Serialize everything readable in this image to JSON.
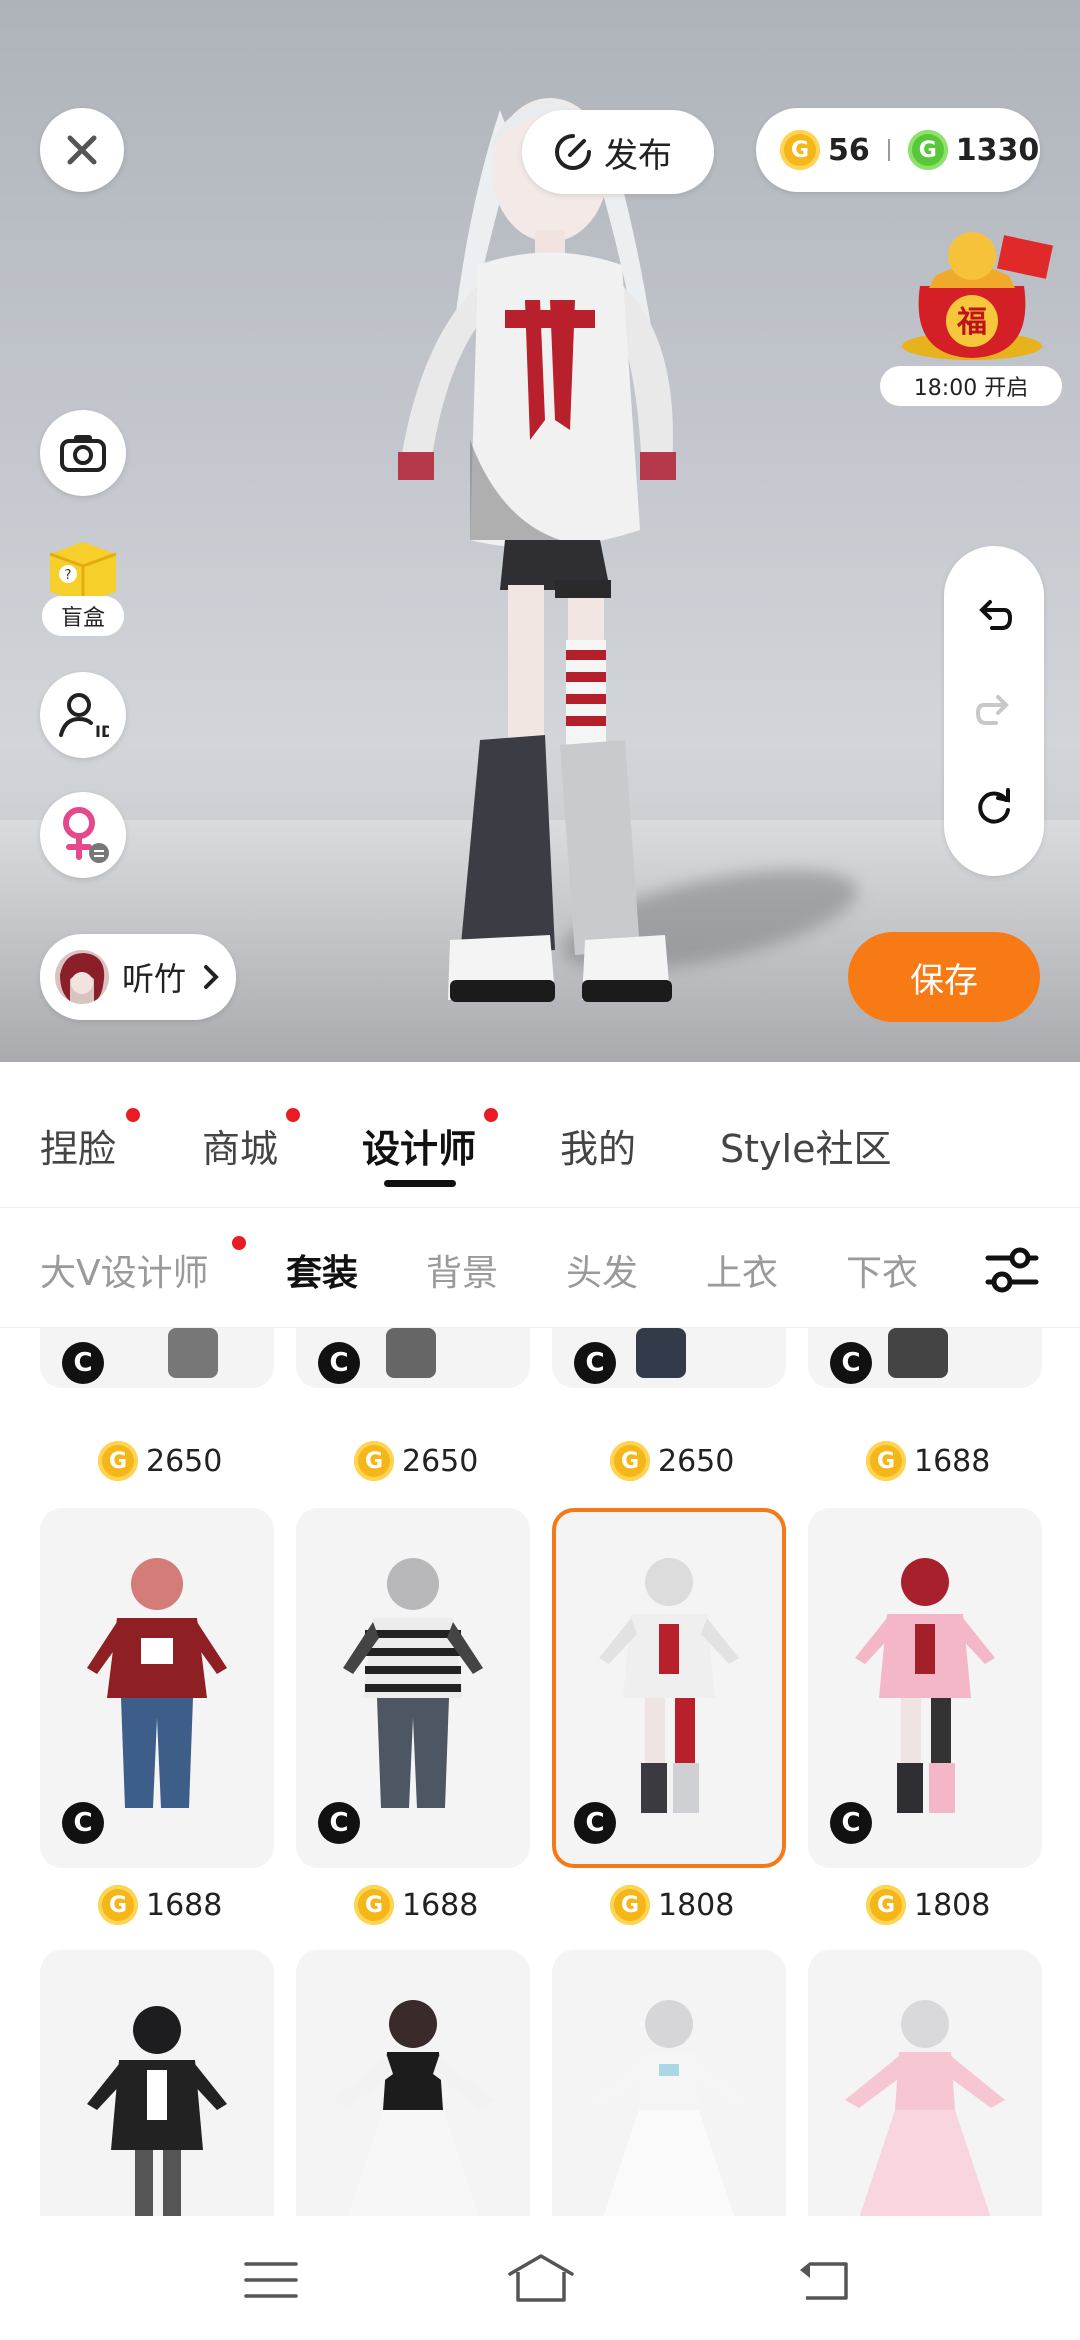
{
  "header": {
    "publish_label": "发布",
    "gold_coins": "56",
    "green_coins": "1330",
    "event_time": "18:00 开启",
    "event_icon_text": "福"
  },
  "left_tools": {
    "blindbox_label": "盲盒"
  },
  "user": {
    "name": "听竹"
  },
  "save_label": "保存",
  "main_tabs": [
    {
      "label": "捏脸",
      "dot": true
    },
    {
      "label": "商城",
      "dot": true
    },
    {
      "label": "设计师",
      "dot": true,
      "active": true
    },
    {
      "label": "我的",
      "dot": false
    },
    {
      "label": "Style社区",
      "dot": false
    }
  ],
  "sub_tabs": [
    {
      "label": "大V设计师",
      "dot": true
    },
    {
      "label": "套装",
      "active": true
    },
    {
      "label": "背景"
    },
    {
      "label": "头发"
    },
    {
      "label": "上衣"
    },
    {
      "label": "下衣"
    }
  ],
  "badge_letter": "C",
  "grid": {
    "row1_prices": [
      "2650",
      "2650",
      "2650",
      "1688"
    ],
    "row2_prices": [
      "1688",
      "1688",
      "1808",
      "1808"
    ],
    "selected_index": 6
  },
  "colors": {
    "accent": "#f77a14",
    "red_dot": "#e81c24",
    "gold_coin": "#f4b619",
    "green_coin": "#58c83a"
  }
}
